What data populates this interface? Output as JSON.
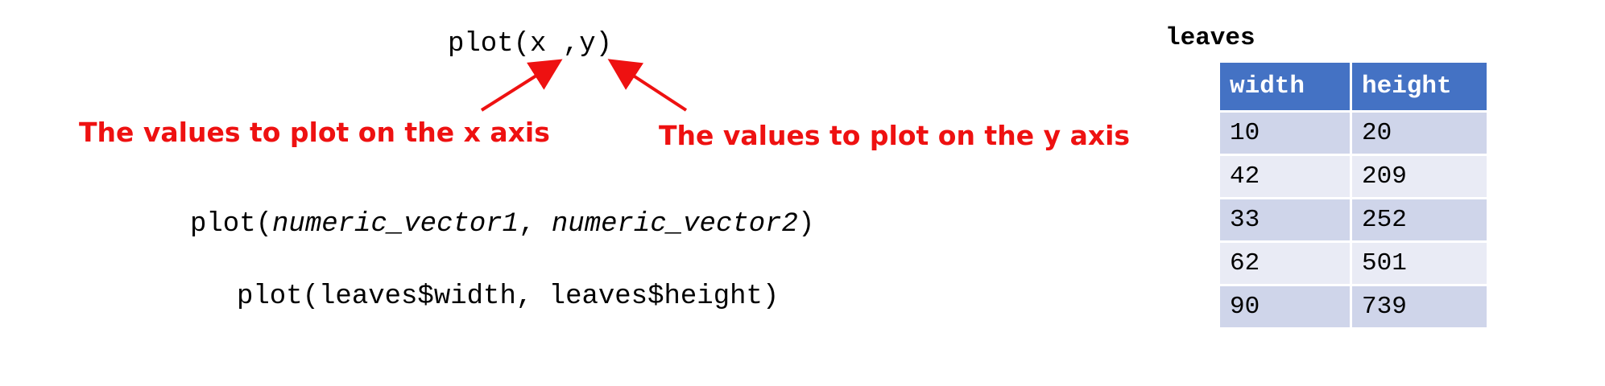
{
  "code": {
    "top": "plot(x ,y)",
    "generic_prefix": "plot(",
    "generic_arg1": "numeric_vector1",
    "generic_sep": ", ",
    "generic_arg2": "numeric_vector2",
    "generic_suffix": ")",
    "example": "plot(leaves$width, leaves$height)"
  },
  "annotations": {
    "x_axis": "The values to plot on the x axis",
    "y_axis": "The values to plot on the y axis",
    "color": "#ee1111"
  },
  "table": {
    "title": "leaves",
    "header_color": "#4472c4",
    "columns": [
      "width",
      "height"
    ],
    "rows": [
      {
        "width": "10",
        "height": "20"
      },
      {
        "width": "42",
        "height": "209"
      },
      {
        "width": "33",
        "height": "252"
      },
      {
        "width": "62",
        "height": "501"
      },
      {
        "width": "90",
        "height": "739"
      }
    ]
  }
}
